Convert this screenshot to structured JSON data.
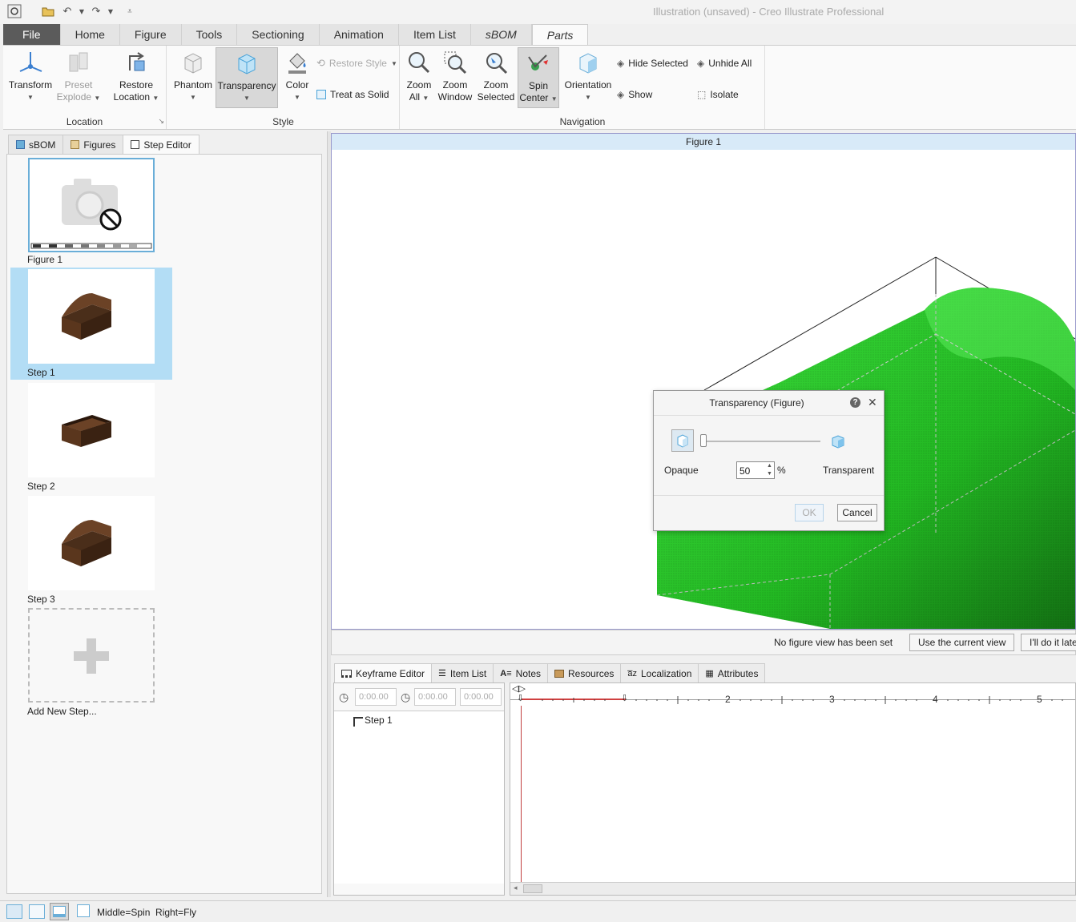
{
  "window": {
    "title": "Illustration (unsaved) - Creo Illustrate Professional"
  },
  "ribbon_tabs": [
    "File",
    "Home",
    "Figure",
    "Tools",
    "Sectioning",
    "Animation",
    "Item List",
    "sBOM",
    "Parts"
  ],
  "ribbon": {
    "location": {
      "label": "Location",
      "transform": "Transform",
      "preset": "Preset",
      "explode": "Explode",
      "restore": "Restore",
      "location_word": "Location"
    },
    "style": {
      "label": "Style",
      "phantom": "Phantom",
      "transparency": "Transparency",
      "color": "Color",
      "restore_style": "Restore Style",
      "treat_as_solid": "Treat as Solid"
    },
    "navigation": {
      "label": "Navigation",
      "zoom": "Zoom",
      "all": "All",
      "window": "Window",
      "selected": "Selected",
      "spin": "Spin",
      "center": "Center",
      "orientation": "Orientation",
      "hide_selected": "Hide Selected",
      "unhide_all": "Unhide All",
      "show": "Show",
      "isolate": "Isolate"
    }
  },
  "left_tabs": [
    "sBOM",
    "Figures",
    "Step Editor"
  ],
  "steps": [
    {
      "label": "Figure 1"
    },
    {
      "label": "Step 1"
    },
    {
      "label": "Step 2"
    },
    {
      "label": "Step 3"
    },
    {
      "label": "Add New Step..."
    }
  ],
  "viewport": {
    "figure_title": "Figure 1",
    "model_color": "#2ecc2e"
  },
  "figure_bar": {
    "message": "No figure view has been set",
    "use_current": "Use the current view",
    "later": "I'll do it later"
  },
  "dialog": {
    "title": "Transparency (Figure)",
    "opaque": "Opaque",
    "transparent": "Transparent",
    "value": "50",
    "unit": "%",
    "slider_fraction": 0.0,
    "ok": "OK",
    "cancel": "Cancel"
  },
  "bottom_tabs": [
    "Keyframe Editor",
    "Item List",
    "Notes",
    "Resources",
    "Localization",
    "Attributes"
  ],
  "keyframe": {
    "times": [
      "0:00.00",
      "0:00.00",
      "0:00.00"
    ],
    "tree_item": "Step 1",
    "ticks": [
      "2",
      "3",
      "4",
      "5"
    ]
  },
  "statusbar": {
    "hint": "Middle=Spin  Right=Fly"
  },
  "colors": {
    "accent_blue": "#b3ddf5",
    "file_tab": "#5b5b5b"
  }
}
